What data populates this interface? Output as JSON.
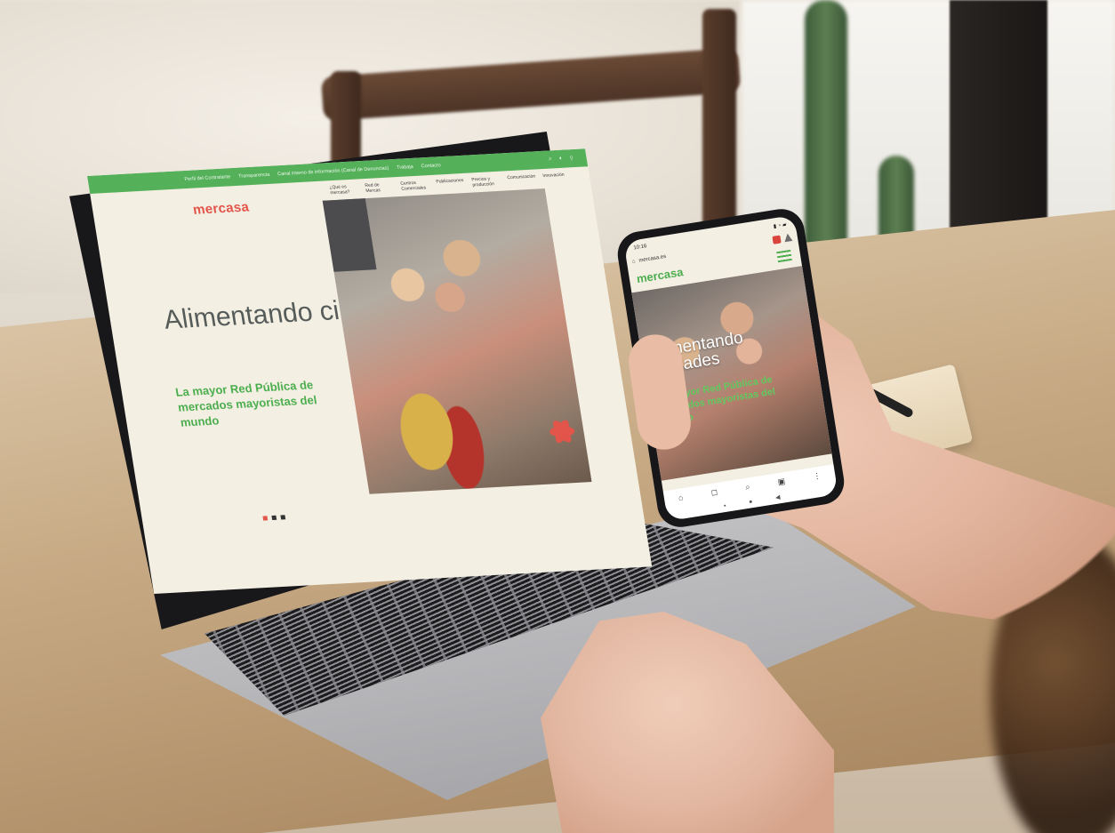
{
  "laptop_site": {
    "utility_links": [
      "Perfil del Contratante",
      "Transparencia",
      "Canal interno de información (Canal de Denuncias)",
      "Trabaja",
      "Contacto"
    ],
    "brand": "mercasa",
    "nav_items": [
      "¿Qué es mercasa?",
      "Red de Mercas",
      "Centros Comerciales",
      "Publicaciones",
      "Precios y producción",
      "Comunicación",
      "Innovación"
    ],
    "hero_title": "Alimentando ciudades",
    "hero_subtitle": "La mayor Red Pública de mercados mayoristas del mundo",
    "slides_total": 3,
    "slide_active": 1
  },
  "phone_site": {
    "status_time": "10:16",
    "url": "mercasa.es",
    "brand": "mercasa",
    "hero_title": "Alimentando ciudades",
    "hero_subtitle": "La mayor Red Pública de mercados mayoristas del mundo",
    "toolbar_icons": [
      "home-icon",
      "bookmark-icon",
      "search-icon",
      "tabs-icon",
      "more-icon"
    ],
    "nav_icons": [
      "menu-icon",
      "home-circle-icon",
      "back-icon"
    ]
  },
  "colors": {
    "brand_green": "#55b05a",
    "brand_red": "#e3554a",
    "page_bg": "#f4efe3"
  }
}
